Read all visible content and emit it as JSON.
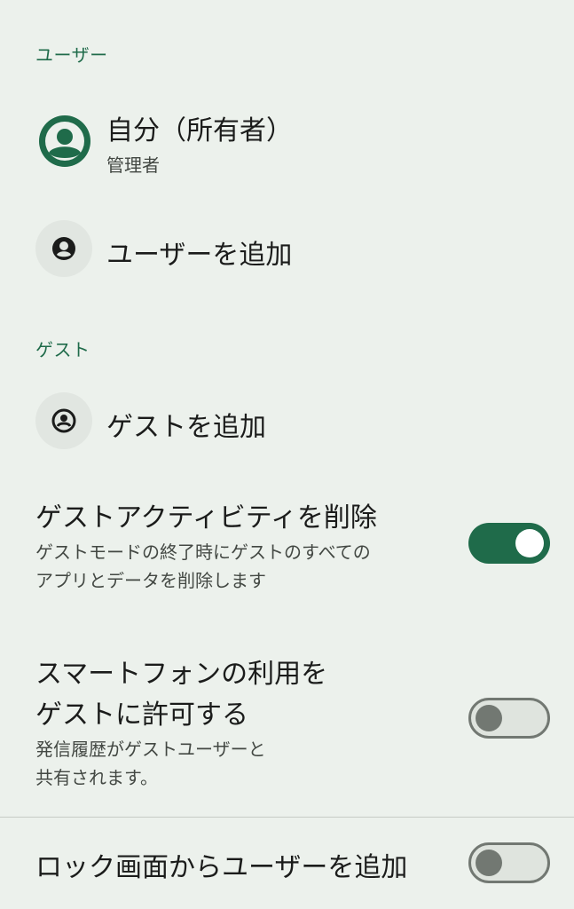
{
  "users_section": {
    "header": "ユーザー",
    "owner": {
      "name": "自分（所有者）",
      "role": "管理者"
    },
    "add_user_label": "ユーザーを追加"
  },
  "guest_section": {
    "header": "ゲスト",
    "add_guest_label": "ゲストを追加",
    "delete_activity": {
      "title": "ゲストアクティビティを削除",
      "desc_line1": "ゲストモードの終了時にゲストのすべての",
      "desc_line2": "アプリとデータを削除します",
      "enabled": true
    },
    "allow_calls": {
      "title_line1": "スマートフォンの利用を",
      "title_line2": "ゲストに許可する",
      "desc_line1": "発信履歴がゲストユーザーと",
      "desc_line2": "共有されます。",
      "enabled": false
    }
  },
  "lockscreen": {
    "title": "ロック画面からユーザーを追加",
    "enabled": false
  },
  "colors": {
    "background": "#ecf1ec",
    "accent": "#1f6b4a",
    "toggle_off": "#727872"
  },
  "icons": {
    "owner_avatar": "account-circle-icon",
    "add_user": "person-add-icon",
    "add_guest": "guest-icon"
  }
}
